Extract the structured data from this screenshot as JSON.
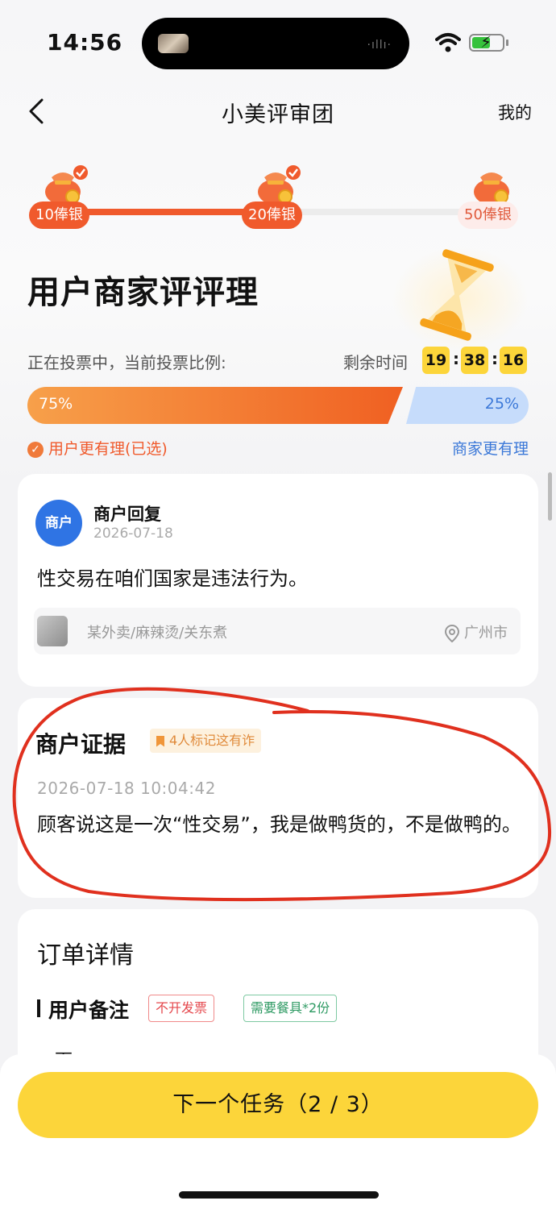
{
  "status_bar": {
    "time": "14:56",
    "wave": "·ıllı·"
  },
  "nav": {
    "title": "小美评审团",
    "mine": "我的"
  },
  "rewards": [
    {
      "label": "10俸银",
      "claimed": true
    },
    {
      "label": "20俸银",
      "claimed": true
    },
    {
      "label": "50俸银",
      "claimed": false
    }
  ],
  "main_title": "用户商家评评理",
  "vote": {
    "label": "正在投票中，当前投票比例:",
    "remaining_label": "剩余时间",
    "time": {
      "h": "19",
      "m": "38",
      "s": "16"
    },
    "sep": ":",
    "user_pct": "75%",
    "merchant_pct": "25%",
    "user_share": 0.75,
    "pick_user": "用户更有理(已选)",
    "pick_merchant": "商家更有理"
  },
  "reply": {
    "avatar": "商户",
    "title": "商户回复",
    "date": "2026-07-18",
    "text": "性交易在咱们国家是违法行为。",
    "shop": "某外卖/麻辣烫/关东煮",
    "location": "广州市"
  },
  "evidence": {
    "title": "商户证据",
    "tag": "4人标记这有诈",
    "datetime": "2026-07-18 10:04:42",
    "text": "顾客说这是一次“性交易”，我是做鸭货的，不是做鸭的。"
  },
  "order": {
    "title": "订单详情",
    "note_title": "用户备注",
    "tags": [
      "不开发票",
      "需要餐具*2份"
    ],
    "note_peek": "下"
  },
  "next_button": "下一个任务（2 / 3）",
  "colors": {
    "accent": "#f05a2c",
    "yellow": "#fcd53a",
    "blue": "#3b78d8",
    "annotation_red": "#e0301e"
  }
}
